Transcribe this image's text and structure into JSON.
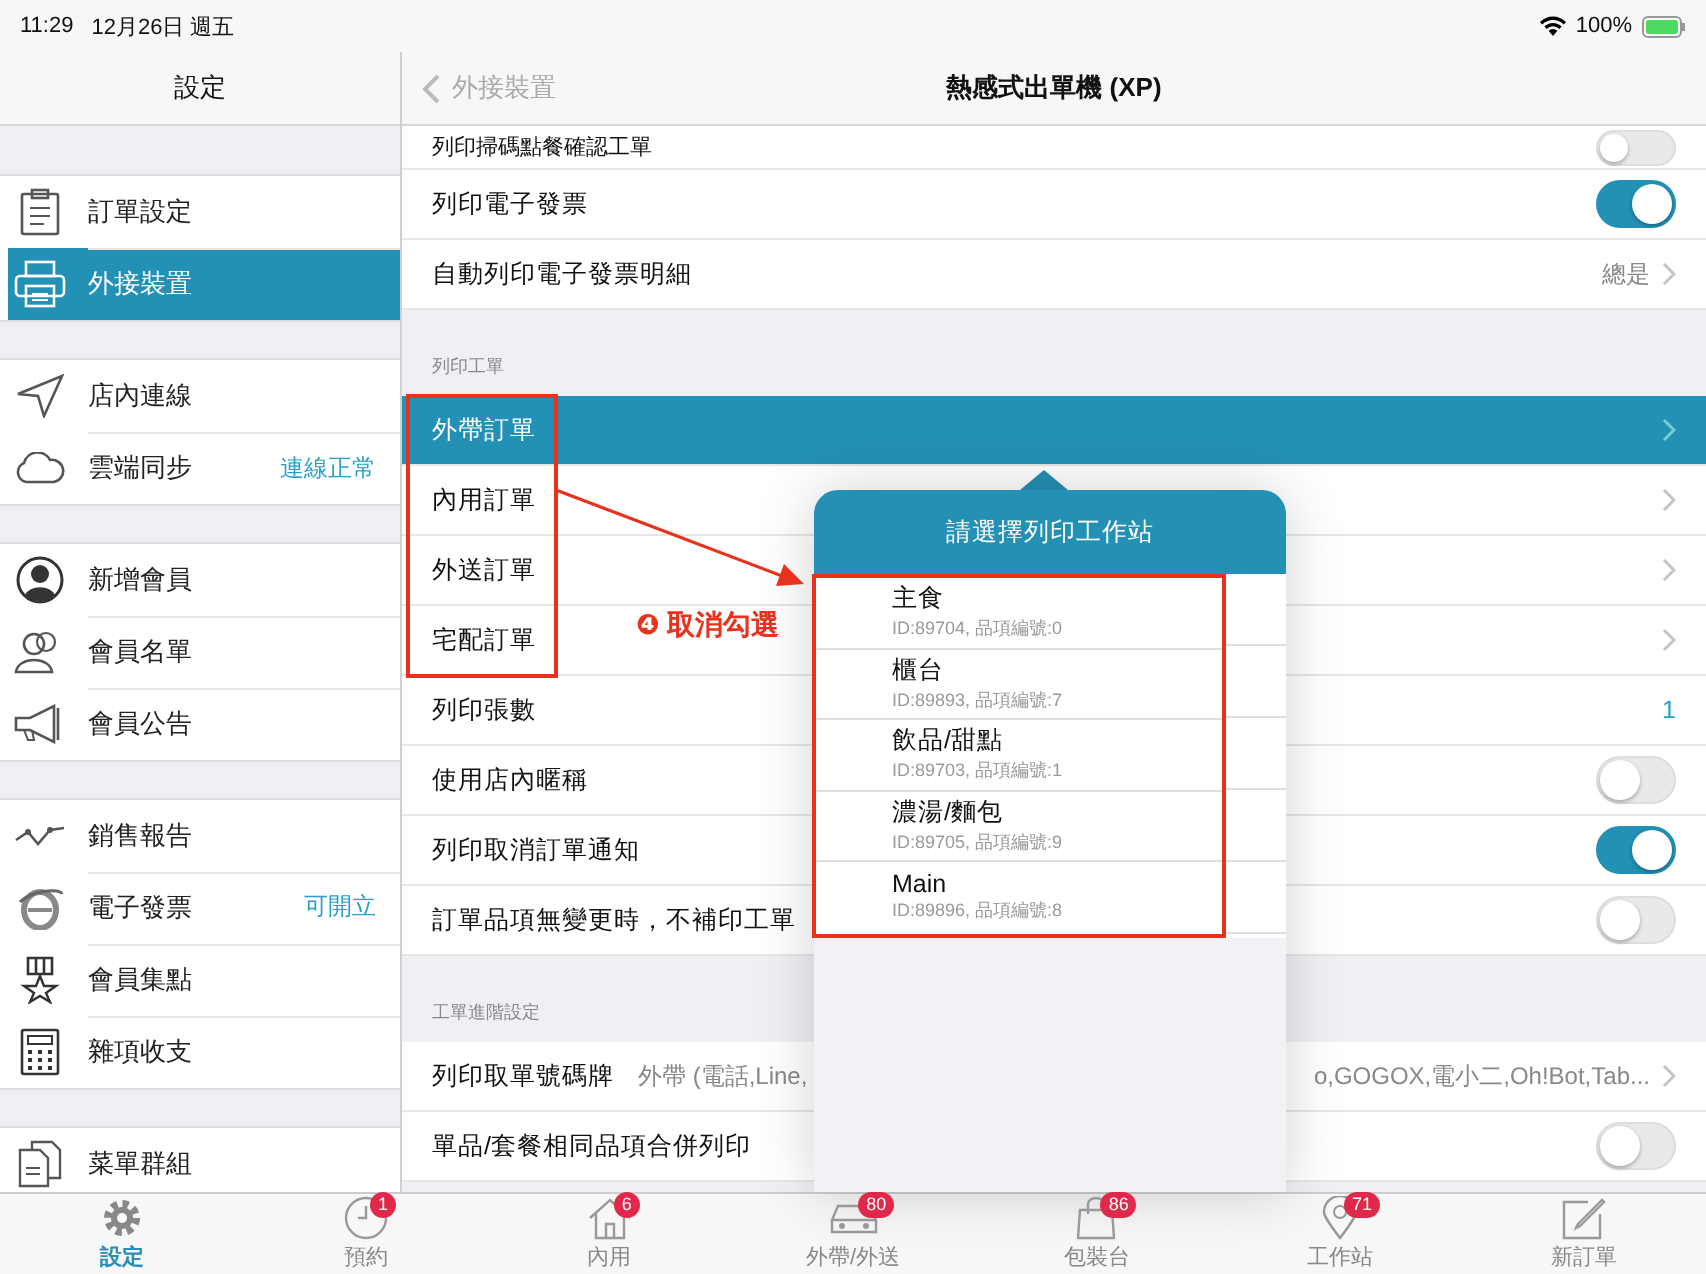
{
  "status_bar": {
    "time": "11:29",
    "date": "12月26日 週五",
    "battery": "100%"
  },
  "sidebar": {
    "title": "設定",
    "groups": [
      [
        {
          "label": "訂單設定",
          "selected": false
        },
        {
          "label": "外接裝置",
          "selected": true
        }
      ],
      [
        {
          "label": "店內連線",
          "selected": false
        },
        {
          "label": "雲端同步",
          "value": "連線正常",
          "selected": false
        }
      ],
      [
        {
          "label": "新增會員",
          "selected": false
        },
        {
          "label": "會員名單",
          "selected": false
        },
        {
          "label": "會員公告",
          "selected": false
        }
      ],
      [
        {
          "label": "銷售報告",
          "selected": false
        },
        {
          "label": "電子發票",
          "value": "可開立",
          "selected": false
        },
        {
          "label": "會員集點",
          "selected": false
        },
        {
          "label": "雜項收支",
          "selected": false
        }
      ],
      [
        {
          "label": "菜單群組",
          "selected": false
        }
      ]
    ]
  },
  "detail": {
    "back": "外接裝置",
    "title": "熱感式出單機 (XP)",
    "sections": [
      {
        "rows": [
          {
            "kind": "toggle",
            "label": "列印掃碼點餐確認工單",
            "on": false
          },
          {
            "kind": "toggle",
            "label": "列印電子發票",
            "on": true
          },
          {
            "kind": "value",
            "label": "自動列印電子發票明細",
            "value": "總是"
          }
        ]
      },
      {
        "header": "列印工單",
        "rows": [
          {
            "kind": "disclosure",
            "label": "外帶訂單",
            "selected": true
          },
          {
            "kind": "disclosure",
            "label": "內用訂單",
            "selected": false
          },
          {
            "kind": "disclosure",
            "label": "外送訂單",
            "selected": false
          },
          {
            "kind": "disclosure",
            "label": "宅配訂單",
            "selected": false
          },
          {
            "kind": "count",
            "label": "列印張數",
            "value": "1",
            "selected": false
          },
          {
            "kind": "toggle",
            "label": "使用店內暱稱",
            "on": false,
            "selected": false
          },
          {
            "kind": "toggle",
            "label": "列印取消訂單通知",
            "on": true,
            "selected": false
          },
          {
            "kind": "toggle",
            "label": "訂單品項無變更時，不補印工單",
            "on": false,
            "selected": false
          }
        ]
      },
      {
        "header": "工單進階設定",
        "rows": [
          {
            "kind": "split_value",
            "label": "列印取單號碼牌",
            "value_start": "外帶 (電話,Line,",
            "value_end": "o,GOGOX,電小二,Oh!Bot,Tab..."
          },
          {
            "kind": "toggle",
            "label": "單品/套餐相同品項合併列印",
            "on": false
          }
        ]
      }
    ]
  },
  "popover": {
    "title": "請選擇列印工作站",
    "items": [
      {
        "name": "主食",
        "detail": "ID:89704, 品項編號:0",
        "checked": false
      },
      {
        "name": "櫃台",
        "detail": "ID:89893, 品項編號:7",
        "checked": false
      },
      {
        "name": "飲品/甜點",
        "detail": "ID:89703, 品項編號:1",
        "checked": false
      },
      {
        "name": "濃湯/麵包",
        "detail": "ID:89705, 品項編號:9",
        "checked": false
      },
      {
        "name": "Main",
        "detail": "ID:89896, 品項編號:8",
        "checked": false
      }
    ]
  },
  "annotation": {
    "text": "❹ 取消勾選"
  },
  "tab_bar": [
    {
      "label": "設定",
      "selected": true
    },
    {
      "label": "預約",
      "badge": "1",
      "selected": false
    },
    {
      "label": "內用",
      "badge": "6",
      "selected": false
    },
    {
      "label": "外帶/外送",
      "badge": "80",
      "selected": false
    },
    {
      "label": "包裝台",
      "badge": "86",
      "selected": false
    },
    {
      "label": "工作站",
      "badge": "71",
      "selected": false
    },
    {
      "label": "新訂單",
      "selected": false
    }
  ]
}
